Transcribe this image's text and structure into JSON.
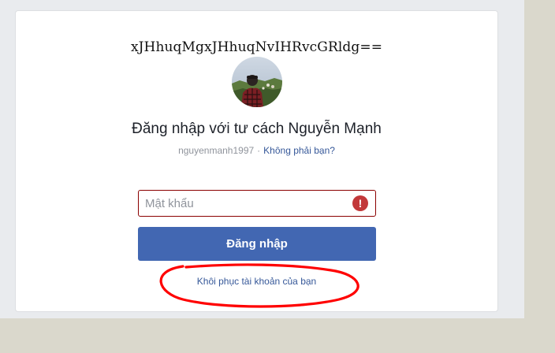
{
  "card": {
    "hash_text": "xJHhuqMgxJHhuqNvIHRvcGRldg==",
    "avatar_alt": "Nguyễn Mạnh",
    "title": "Đăng nhập với tư cách Nguyễn Mạnh",
    "username": "nguyenmanh1997",
    "separator": "·",
    "not_you_link": "Không phải bạn?",
    "password": {
      "placeholder": "Mật khẩu",
      "value": "",
      "error_icon": "exclamation-icon",
      "error_glyph": "!"
    },
    "login_button": "Đăng nhập",
    "recover_link": "Khôi phục tài khoản của bạn"
  },
  "colors": {
    "brand_blue": "#4267b2",
    "link_blue": "#365899",
    "error_red": "#c2383a",
    "annotation_red": "#ff0000"
  }
}
